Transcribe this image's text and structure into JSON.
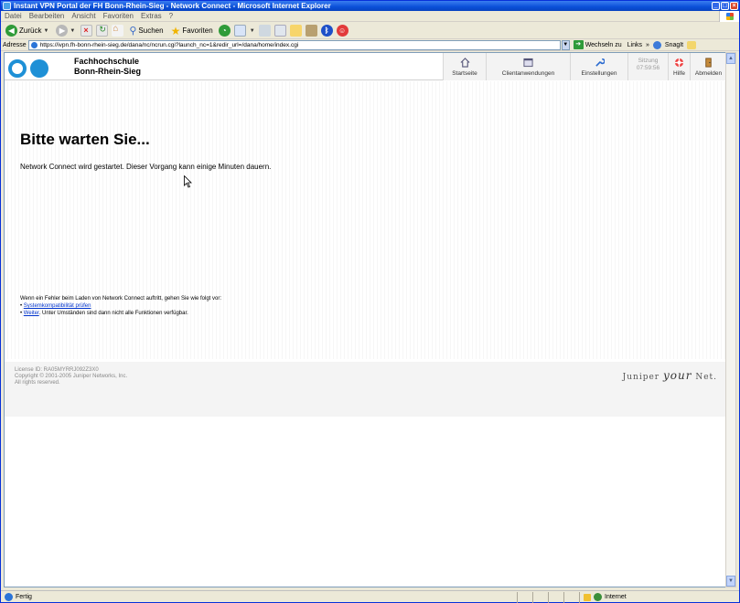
{
  "window": {
    "title": "Instant VPN Portal der FH Bonn-Rhein-Sieg - Network Connect - Microsoft Internet Explorer",
    "controls": [
      "_",
      "□",
      "×"
    ]
  },
  "menu": [
    "Datei",
    "Bearbeiten",
    "Ansicht",
    "Favoriten",
    "Extras",
    "?"
  ],
  "toolbar": {
    "back_label": "Zurück",
    "search_label": "Suchen",
    "favorites_label": "Favoriten"
  },
  "address": {
    "label": "Adresse",
    "url": "https://ivpn.fh-bonn-rhein-sieg.de/dana/nc/ncrun.cgi?launch_nc=1&redir_url=/dana/home/index.cgi",
    "go_label": "Wechseln zu",
    "links_label": "Links",
    "chevron": "»",
    "snagit_label": "SnagIt"
  },
  "header": {
    "org_line1": "Fachhochschule",
    "org_line2": "Bonn-Rhein-Sieg",
    "nav": {
      "home": "Startseite",
      "clients": "Clientanwendungen",
      "settings": "Einstellungen",
      "session_label": "Sitzung",
      "session_time": "07:59:56",
      "help": "Hilfe",
      "logout": "Abmelden"
    }
  },
  "main": {
    "heading": "Bitte warten Sie...",
    "message": "Network Connect wird gestartet. Dieser Vorgang kann einige Minuten dauern.",
    "error_intro": "Wenn ein Fehler beim Laden von Network Connect auftritt, gehen Sie wie folgt vor:",
    "error_link1": "Systemkompatibilität prüfen",
    "error_link2": "Weiter",
    "error_link2_suffix": ". Unter Umständen sind dann nicht alle Funktionen verfügbar."
  },
  "footer": {
    "license": "License ID: RA05MYRRJ092Z3X0",
    "copyright": "Copyright © 2001-2005 Juniper Networks, Inc.",
    "rights": "All rights reserved.",
    "brand_a": "Juniper",
    "brand_b": "your",
    "brand_c": "Net."
  },
  "status": {
    "text": "Fertig",
    "zone": "Internet"
  }
}
